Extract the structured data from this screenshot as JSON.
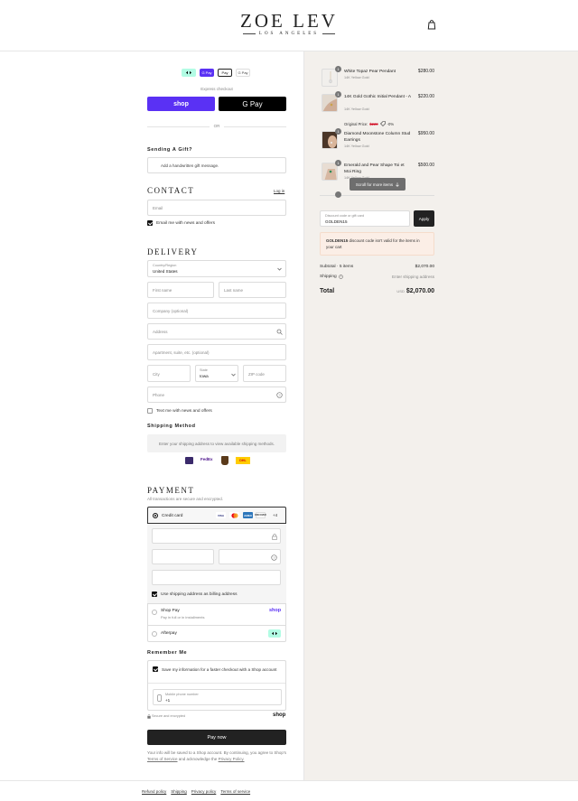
{
  "header": {
    "brand": "ZOE LEV",
    "brand_sub": "LOS ANGELES",
    "cart_icon": "bag-icon"
  },
  "express": {
    "label": "Express checkout",
    "badges": [
      "",
      "G Pay",
      "Pay",
      "G Pay"
    ],
    "shop_label": "shop",
    "gpay_label": "G Pay",
    "or": "OR"
  },
  "gift": {
    "title": "Sending A Gift?",
    "button": "Add a handwritten gift message."
  },
  "contact": {
    "title": "CONTACT",
    "login": "Log in",
    "email_placeholder": "Email",
    "newsletter": "Email me with news and offers"
  },
  "delivery": {
    "title": "DELIVERY",
    "country_label": "Country/Region",
    "country_value": "United States",
    "first_name": "First name",
    "last_name": "Last name",
    "company": "Company (optional)",
    "address": "Address",
    "apartment": "Apartment, suite, etc. (optional)",
    "city": "City",
    "state_label": "State",
    "state_value": "Iowa",
    "zip": "ZIP code",
    "phone": "Phone",
    "sms": "Text me with news and offers"
  },
  "shipping": {
    "title": "Shipping Method",
    "notice": "Enter your shipping address to view available shipping methods.",
    "carriers": [
      "",
      "FedEx",
      "",
      "DHL"
    ]
  },
  "payment": {
    "title": "PAYMENT",
    "subtitle": "All transactions are secure and encrypted.",
    "credit_card": "Credit card",
    "cards": [
      "VISA",
      "",
      "AMEX",
      "DISCOVER"
    ],
    "more": "+4",
    "billing_same": "Use shipping address as billing address",
    "shop_pay": "Shop Pay",
    "shop_pay_sub": "Pay in full or in installments",
    "shop_pay_logo": "shop",
    "afterpay": "Afterpay"
  },
  "remember": {
    "title": "Remember Me",
    "save_info": "Save my information for a faster checkout with a Shop account",
    "mobile_label": "Mobile phone number",
    "mobile_value": "+1",
    "secure": "Secure and encrypted",
    "shop_logo": "shop"
  },
  "pay_now": "Pay now",
  "legal": {
    "text_1": "Your info will be saved to a Shop account. By continuing, you agree to Shop's",
    "terms": "Terms of Service",
    "text_2": "and acknowledge the",
    "privacy": "Privacy Policy."
  },
  "footer": [
    "Refund policy",
    "Shipping",
    "Privacy policy",
    "Terms of service"
  ],
  "order": {
    "items": [
      {
        "qty": "1",
        "name": "White Topaz Pear Pendant",
        "variant": "14K Yellow Gold",
        "price": "$280.00"
      },
      {
        "qty": "1",
        "name": "14K Gold Gothic Initial Pendant - A",
        "variant": "14K Yellow Gold",
        "price": "$220.00",
        "orig_label": "Original Price:",
        "orig_price": "$220",
        "discount": "-0%"
      },
      {
        "qty": "1",
        "name": "Diamond Moonstone Column Stud Earrings",
        "variant": "14K Yellow Gold",
        "price": "$950.00"
      },
      {
        "qty": "1",
        "name": "Emerald and Pear Shape Toi et Moi Ring",
        "variant": "14K Yellow Gold",
        "price": "$500.00"
      }
    ],
    "scroll_hint": "Scroll for more items",
    "discount_label": "Discount code or gift card",
    "discount_value": "GOLDEN15",
    "apply": "Apply",
    "error_code": "GOLDEN15",
    "error_text": "discount code isn't valid for the items in your cart",
    "subtotal_label": "Subtotal · 5 items",
    "subtotal_value": "$2,070.00",
    "shipping_label": "Shipping",
    "shipping_value": "Enter shipping address",
    "total_label": "Total",
    "currency": "USD",
    "total_value": "$2,070.00"
  },
  "colors": {
    "shop_purple": "#5a31f4",
    "accent_error": "#fbeee6",
    "pay_button": "#222222"
  }
}
